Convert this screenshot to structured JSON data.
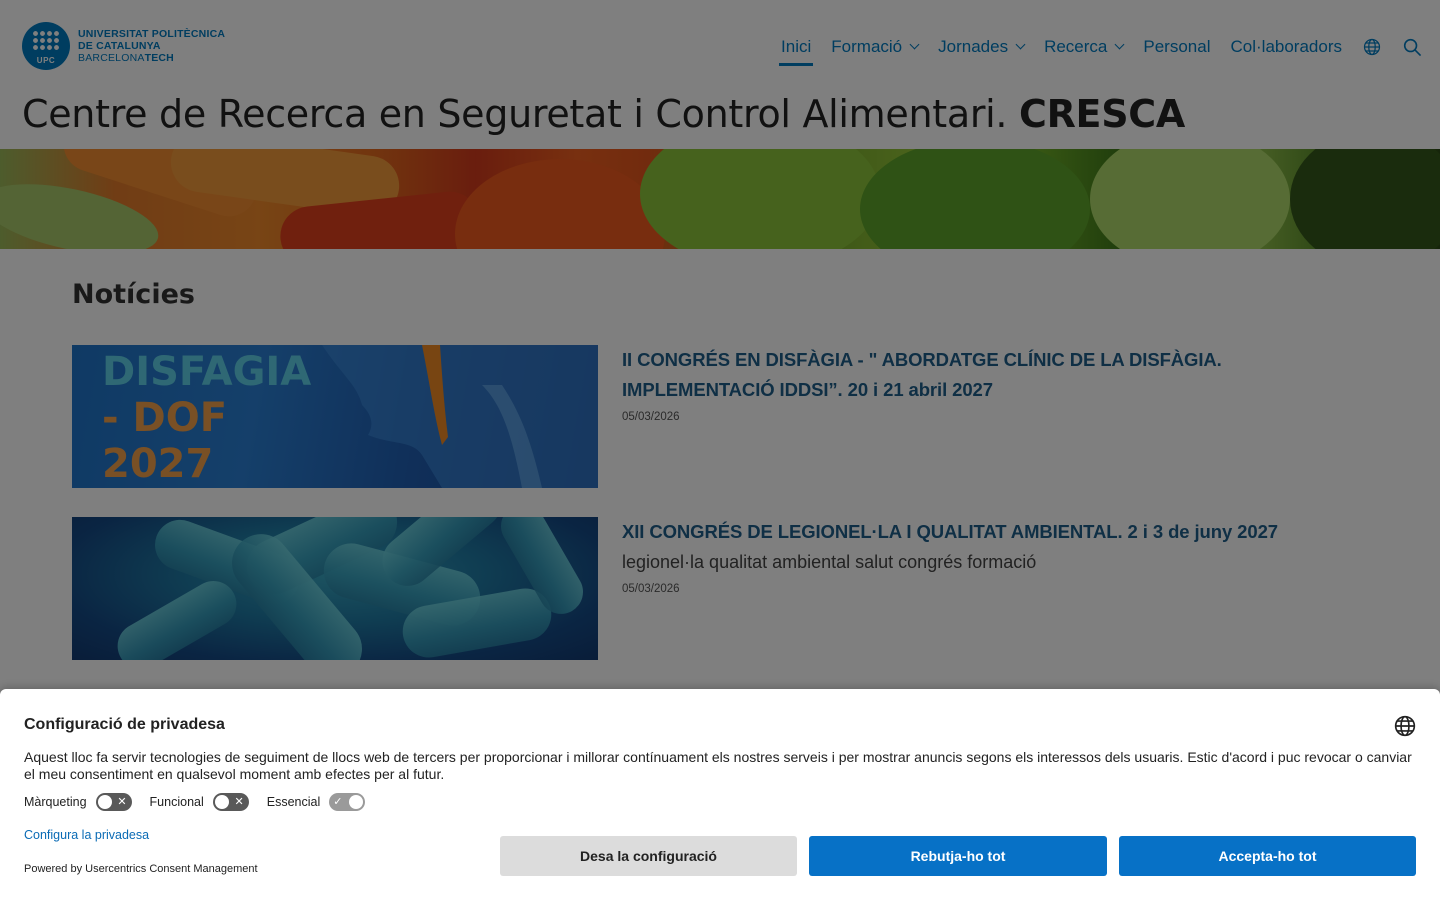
{
  "header": {
    "logo": {
      "badge_text": "UPC",
      "line1": "UNIVERSITAT POLITÈCNICA",
      "line2": "DE CATALUNYA",
      "line3_prefix": "BARCELONA",
      "line3_bold": "TECH"
    },
    "nav": {
      "items": [
        {
          "label": "Inici",
          "active": true,
          "dropdown": false
        },
        {
          "label": "Formació",
          "active": false,
          "dropdown": true
        },
        {
          "label": "Jornades",
          "active": false,
          "dropdown": true
        },
        {
          "label": "Recerca",
          "active": false,
          "dropdown": true
        },
        {
          "label": "Personal",
          "active": false,
          "dropdown": false
        },
        {
          "label": "Col·laboradors",
          "active": false,
          "dropdown": false
        }
      ],
      "language_icon": "globe-icon",
      "search_icon": "search-icon"
    },
    "site_title_prefix": "Centre de Recerca en Seguretat i Control Alimentari. ",
    "site_title_bold": "CRESCA"
  },
  "main": {
    "section_title": "Notícies",
    "news": [
      {
        "image_text": [
          "DISFAGIA",
          "- DOF",
          "2027"
        ],
        "title": "II CONGRÉS EN DISFÀGIA - \" ABORDATGE CLÍNIC DE LA DISFÀGIA. IMPLEMENTACIÓ IDDSI”. 20 i 21 abril 2027",
        "tags": "",
        "date": "05/03/2026"
      },
      {
        "title": "XII CONGRÉS DE LEGIONEL·LA I QUALITAT AMBIENTAL. 2 i 3 de juny 2027",
        "tags": "legionel·la qualitat ambiental salut congrés formació",
        "date": "05/03/2026"
      }
    ]
  },
  "consent": {
    "title": "Configuració de privadesa",
    "text": "Aquest lloc fa servir tecnologies de seguiment de llocs web de tercers per proporcionar i millorar contínuament els nostres serveis i per mostrar anuncis segons els interessos dels usuaris. Estic d'acord i puc revocar o canviar el meu consentiment en qualsevol moment amb efectes per al futur.",
    "toggles": [
      {
        "label": "Màrqueting",
        "on": false
      },
      {
        "label": "Funcional",
        "on": false
      },
      {
        "label": "Essencial",
        "on": true
      }
    ],
    "configure_link": "Configura la privadesa",
    "powered_by": "Powered by Usercentrics Consent Management",
    "buttons": {
      "save": "Desa la configuració",
      "reject": "Rebutja-ho tot",
      "accept": "Accepta-ho tot"
    }
  },
  "colors": {
    "brand_blue": "#007bc0",
    "button_blue": "#0771c6",
    "button_grey": "#dcdcdc",
    "overlay": "rgba(0,0,0,0.5)"
  }
}
